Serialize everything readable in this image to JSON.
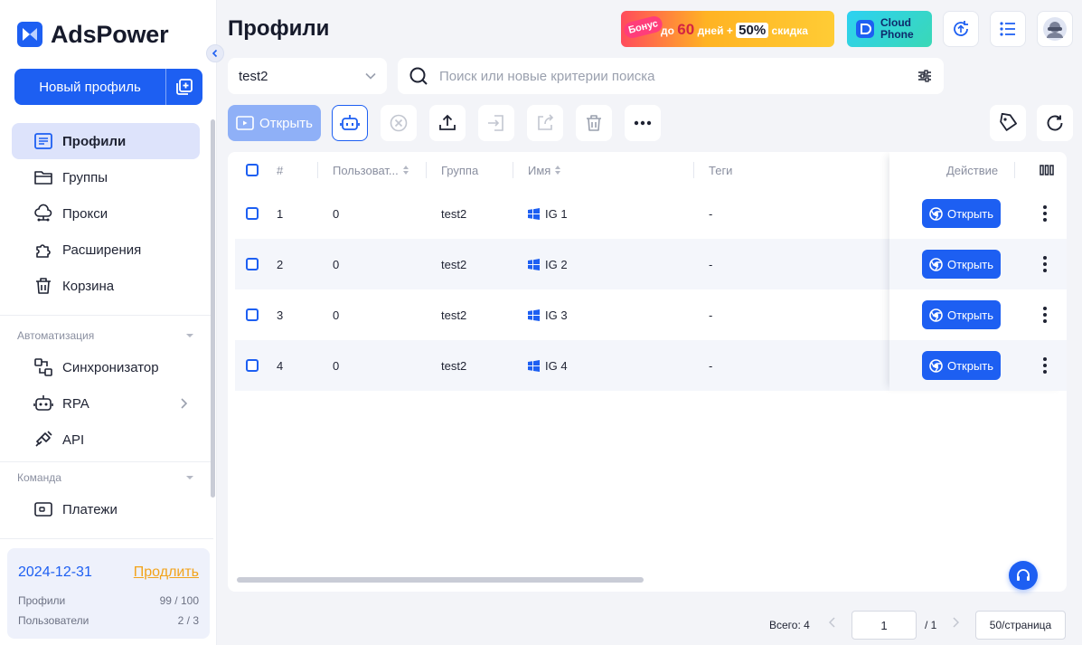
{
  "app": {
    "name": "AdsPower"
  },
  "sidebar": {
    "new_profile_label": "Новый профиль",
    "items": [
      {
        "label": "Профили",
        "icon": "profiles-icon"
      },
      {
        "label": "Группы",
        "icon": "folder-icon"
      },
      {
        "label": "Прокси",
        "icon": "proxy-icon"
      },
      {
        "label": "Расширения",
        "icon": "puzzle-icon"
      },
      {
        "label": "Корзина",
        "icon": "trash-icon"
      }
    ],
    "automation": {
      "title": "Автоматизация",
      "items": [
        {
          "label": "Синхронизатор",
          "icon": "sync-icon"
        },
        {
          "label": "RPA",
          "icon": "robot-icon"
        },
        {
          "label": "API",
          "icon": "api-plug-icon"
        }
      ]
    },
    "team": {
      "title": "Команда",
      "items": [
        {
          "label": "Платежи",
          "icon": "wallet-icon"
        }
      ]
    },
    "subscription": {
      "date": "2024-12-31",
      "renew_label": "Продлить",
      "profiles_label": "Профили",
      "profiles_value": "99 / 100",
      "users_label": "Пользователи",
      "users_value": "2 / 3"
    }
  },
  "header": {
    "title": "Профили",
    "promo": {
      "bonus": "Бонус",
      "prefix": "до",
      "days_num": "60",
      "days_label": "дней +",
      "percent": "50%",
      "suffix": "скидка"
    },
    "cloud_phone": {
      "line1": "Cloud",
      "line2": "Phone"
    }
  },
  "filters": {
    "group_value": "test2",
    "search_placeholder": "Поиск или новые критерии поиска"
  },
  "toolbar": {
    "open_label": "Открыть"
  },
  "table": {
    "columns": [
      "#",
      "Пользоват...",
      "Группа",
      "Имя",
      "Теги",
      "Действие"
    ],
    "open_label": "Открыть",
    "rows": [
      {
        "num": "1",
        "user": "0",
        "group": "test2",
        "name": "IG 1",
        "tags": "-"
      },
      {
        "num": "2",
        "user": "0",
        "group": "test2",
        "name": "IG 2",
        "tags": "-"
      },
      {
        "num": "3",
        "user": "0",
        "group": "test2",
        "name": "IG 3",
        "tags": "-"
      },
      {
        "num": "4",
        "user": "0",
        "group": "test2",
        "name": "IG 4",
        "tags": "-"
      }
    ]
  },
  "pagination": {
    "total": "Всего: 4",
    "current_page": "1",
    "of_pages": "/ 1",
    "page_size": "50/страница"
  },
  "colors": {
    "accent": "#1d5ff2",
    "active_nav": "#dde3fb",
    "renew": "#f2a31b"
  }
}
